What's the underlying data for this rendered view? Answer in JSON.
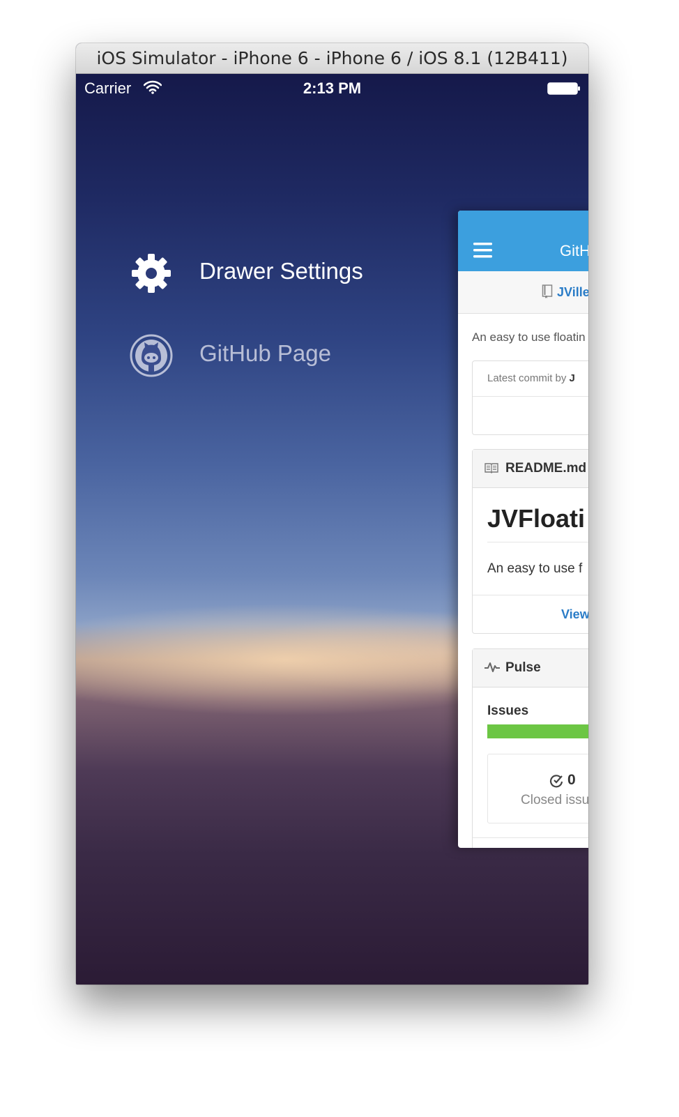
{
  "window": {
    "title": "iOS Simulator - iPhone 6 - iPhone 6 / iOS 8.1 (12B411)"
  },
  "status_bar": {
    "carrier": "Carrier",
    "time": "2:13 PM",
    "wifi_icon": "wifi-icon",
    "battery_icon": "battery-icon"
  },
  "drawer": {
    "items": [
      {
        "label": "Drawer Settings",
        "icon": "gear-icon",
        "selected": true
      },
      {
        "label": "GitHub Page",
        "icon": "github-octocat-icon",
        "selected": false
      }
    ]
  },
  "content": {
    "nav_title": "GitH",
    "menu_icon": "hamburger-menu-icon",
    "repo_name": "JVille",
    "description": "An easy to use floatin",
    "commit_prefix": "Latest commit by ",
    "commit_author": "J",
    "readme": {
      "title": "README.md",
      "heading": "JVFloati",
      "paragraph": "An easy to use f",
      "view_link": "View"
    },
    "pulse": {
      "title": "Pulse",
      "issues_label": "Issues",
      "closed_count": "0",
      "closed_label": "Closed issu"
    }
  },
  "colors": {
    "navbar": "#3c9fde",
    "link": "#2a7cc7",
    "issues_bar": "#6cc644"
  }
}
